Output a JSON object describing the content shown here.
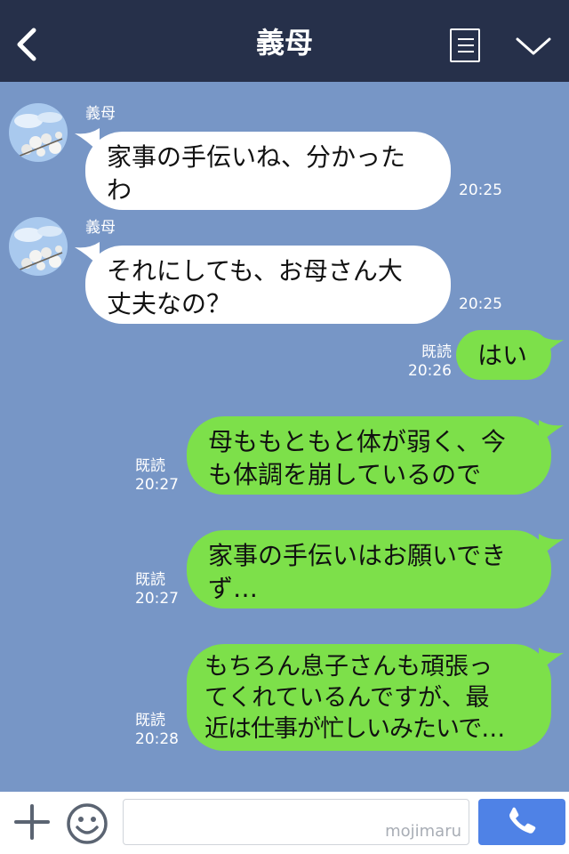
{
  "header": {
    "title": "義母"
  },
  "input": {
    "watermark": "mojimaru",
    "placeholder": ""
  },
  "colors": {
    "header_bg": "#26304a",
    "chat_bg": "#7796c6",
    "incoming_bubble": "#ffffff",
    "outgoing_bubble": "#7de04a",
    "call_button": "#4f82e6"
  },
  "icons": [
    "back-chevron-icon",
    "menu-list-icon",
    "collapse-chevron-icon",
    "plus-icon",
    "emoji-icon",
    "phone-icon"
  ],
  "messages": [
    {
      "direction": "in",
      "sender": "義母",
      "lines": [
        "家事の手伝いね、分かった",
        "わ"
      ],
      "time": "20:25"
    },
    {
      "direction": "in",
      "sender": "義母",
      "lines": [
        "それにしても、お母さん大",
        "丈夫なの？"
      ],
      "time": "20:25"
    },
    {
      "direction": "out",
      "read": "既読",
      "lines": [
        "はい"
      ],
      "time": "20:26"
    },
    {
      "direction": "out",
      "read": "既読",
      "lines": [
        "母ももともと体が弱く、今",
        "も体調を崩しているので"
      ],
      "time": "20:27"
    },
    {
      "direction": "out",
      "read": "既読",
      "lines": [
        "家事の手伝いはお願いでき",
        "ず…"
      ],
      "time": "20:27"
    },
    {
      "direction": "out",
      "read": "既読",
      "lines": [
        "もちろん息子さんも頑張っ",
        "てくれているんですが、最",
        "近は仕事が忙しいみたいで…"
      ],
      "time": "20:28"
    }
  ]
}
